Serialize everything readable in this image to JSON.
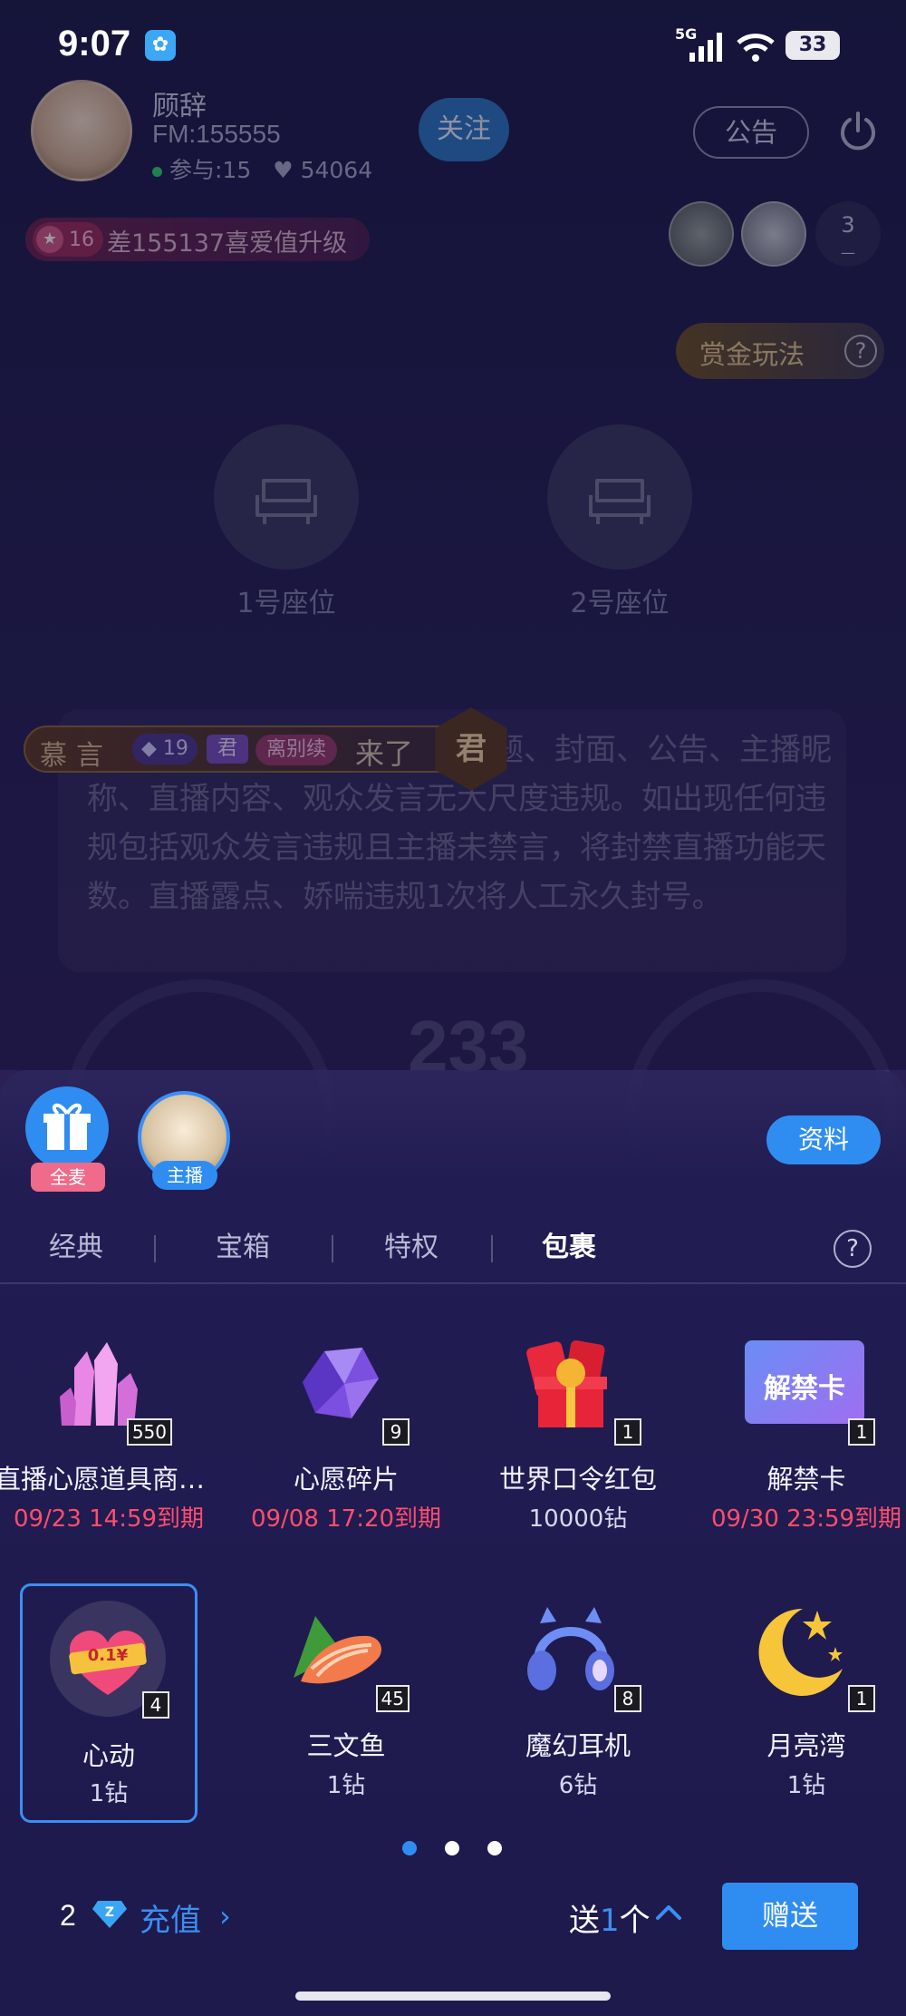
{
  "status_bar": {
    "time": "9:07",
    "network": "5G",
    "battery": "33"
  },
  "room": {
    "host_name": "顾辞",
    "fm_id": "FM:155555",
    "participants": "参与:15",
    "likes": "54064",
    "follow_label": "关注",
    "notice_label": "公告",
    "level_num": "16",
    "level_text": "差155137喜爱值升级",
    "viewer_count": "3",
    "bounty_label": "赏金玩法",
    "seats": [
      "1号座位",
      "2号座位"
    ],
    "chat_text": "播标题、封面、公告、主播昵称、直播内容、观众发言无大尺度违规。如出现任何违规包括观众发言违规且主播未禁言，将封禁直播功能天数。直播露点、娇喘违规1次将人工永久封号。",
    "gauge_number": "233"
  },
  "entry_banner": {
    "user": "慕言",
    "level": "19",
    "badge": "君",
    "tag": "离别续",
    "text": "来了",
    "emblem": "君"
  },
  "gift_panel": {
    "all_mic_label": "全麦",
    "host_label": "主播",
    "info_label": "资料",
    "tabs": [
      "经典",
      "宝箱",
      "特权",
      "包裹"
    ],
    "active_tab": "包裹",
    "items": [
      {
        "name": "直播心愿道具商…",
        "sub": "09/23 14:59到期",
        "count": "550",
        "expiry": true,
        "icon": "crystal-icon"
      },
      {
        "name": "心愿碎片",
        "sub": "09/08 17:20到期",
        "count": "9",
        "expiry": true,
        "icon": "gem-shard-icon"
      },
      {
        "name": "世界口令红包",
        "sub": "10000钻",
        "count": "1",
        "expiry": false,
        "icon": "red-envelope-icon"
      },
      {
        "name": "解禁卡",
        "sub": "09/30 23:59到期",
        "count": "1",
        "expiry": true,
        "icon": "unban-card-icon",
        "card_text": "解禁卡"
      },
      {
        "name": "心动",
        "sub": "1钻",
        "count": "4",
        "expiry": false,
        "icon": "heart-icon",
        "heart_text": "0.1¥"
      },
      {
        "name": "三文鱼",
        "sub": "1钻",
        "count": "45",
        "expiry": false,
        "icon": "salmon-icon"
      },
      {
        "name": "魔幻耳机",
        "sub": "6钻",
        "count": "8",
        "expiry": false,
        "icon": "headphones-icon"
      },
      {
        "name": "月亮湾",
        "sub": "1钻",
        "count": "1",
        "expiry": false,
        "icon": "moon-icon"
      }
    ],
    "page_count": 3,
    "current_page": 1,
    "balance": "2",
    "recharge_label": "充值",
    "send_prefix": "送",
    "send_qty": "1",
    "send_unit": "个",
    "send_button": "赠送",
    "colors": {
      "accent": "#2f8df1",
      "expiry": "#ff4d6d"
    }
  }
}
